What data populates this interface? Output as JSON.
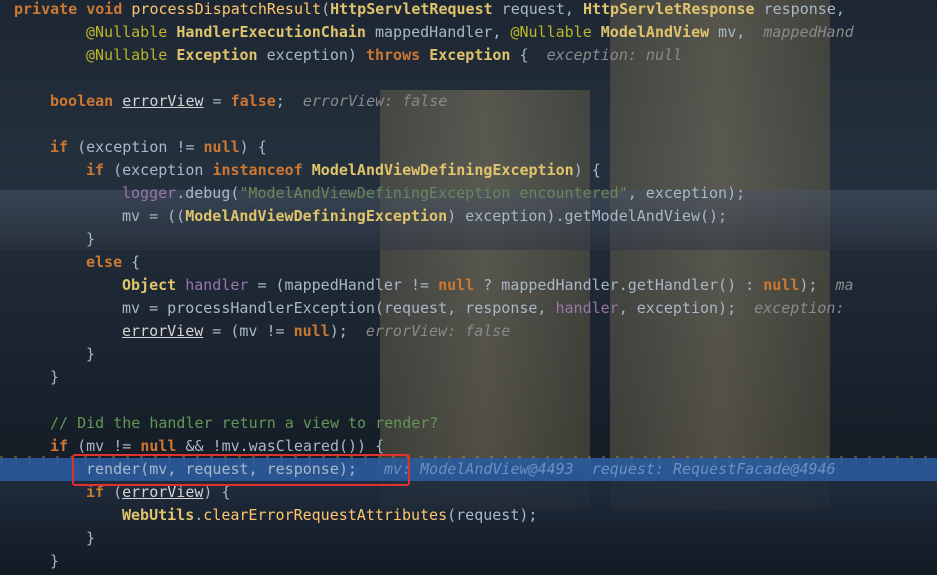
{
  "editor": {
    "lines": [
      {
        "id": "l1",
        "indent": 0,
        "tokens": [
          [
            "kw",
            "private void "
          ],
          [
            "fu",
            "processDispatchResult"
          ],
          [
            "pa",
            "("
          ],
          [
            "ty",
            "HttpServletRequest"
          ],
          [
            "pa",
            " request, "
          ],
          [
            "ty",
            "HttpServletResponse"
          ],
          [
            "pa",
            " response,"
          ]
        ]
      },
      {
        "id": "l2",
        "indent": 8,
        "tokens": [
          [
            "an",
            "@Nullable "
          ],
          [
            "ty",
            "HandlerExecutionChain"
          ],
          [
            "pa",
            " mappedHandler, "
          ],
          [
            "an",
            "@Nullable "
          ],
          [
            "ty",
            "ModelAndView"
          ],
          [
            "pa",
            " mv,  "
          ],
          [
            "hint",
            "mappedHand"
          ]
        ]
      },
      {
        "id": "l3",
        "indent": 8,
        "tokens": [
          [
            "an",
            "@Nullable "
          ],
          [
            "ty",
            "Exception"
          ],
          [
            "pa",
            " exception) "
          ],
          [
            "kw",
            "throws "
          ],
          [
            "ty",
            "Exception"
          ],
          [
            "pa",
            " {  "
          ],
          [
            "hint",
            "exception: null"
          ]
        ]
      },
      {
        "id": "l4",
        "indent": 0,
        "tokens": []
      },
      {
        "id": "l5",
        "indent": 4,
        "tokens": [
          [
            "kw",
            "boolean "
          ],
          [
            "un",
            "errorView"
          ],
          [
            "pa",
            " = "
          ],
          [
            "kw",
            "false"
          ],
          [
            "pa",
            ";  "
          ],
          [
            "hint",
            "errorView: false"
          ]
        ]
      },
      {
        "id": "l6",
        "indent": 0,
        "tokens": []
      },
      {
        "id": "l7",
        "indent": 4,
        "tokens": [
          [
            "kw",
            "if "
          ],
          [
            "pa",
            "(exception != "
          ],
          [
            "kw",
            "null"
          ],
          [
            "pa",
            ") {"
          ]
        ]
      },
      {
        "id": "l8",
        "indent": 8,
        "tokens": [
          [
            "kw",
            "if "
          ],
          [
            "pa",
            "(exception "
          ],
          [
            "kw",
            "instanceof "
          ],
          [
            "ty",
            "ModelAndViewDefiningException"
          ],
          [
            "pa",
            ") {"
          ]
        ]
      },
      {
        "id": "l9",
        "indent": 12,
        "tokens": [
          [
            "fd",
            "logger"
          ],
          [
            "pa",
            ".debug("
          ],
          [
            "st",
            "\"ModelAndViewDefiningException encountered\""
          ],
          [
            "pa",
            ", exception);"
          ]
        ]
      },
      {
        "id": "l10",
        "indent": 12,
        "tokens": [
          [
            "pa",
            "mv = (("
          ],
          [
            "ty",
            "ModelAndViewDefiningException"
          ],
          [
            "pa",
            ") exception).getModelAndView();"
          ]
        ]
      },
      {
        "id": "l11",
        "indent": 8,
        "tokens": [
          [
            "pa",
            "}"
          ]
        ]
      },
      {
        "id": "l12",
        "indent": 8,
        "tokens": [
          [
            "kw",
            "else "
          ],
          [
            "pa",
            "{"
          ]
        ]
      },
      {
        "id": "l13",
        "indent": 12,
        "tokens": [
          [
            "ty",
            "Object "
          ],
          [
            "fd",
            "handler"
          ],
          [
            "pa",
            " = (mappedHandler != "
          ],
          [
            "kw",
            "null"
          ],
          [
            "pa",
            " ? mappedHandler.getHandler() : "
          ],
          [
            "kw",
            "null"
          ],
          [
            "pa",
            ");  "
          ],
          [
            "hint",
            "ma"
          ]
        ]
      },
      {
        "id": "l14",
        "indent": 12,
        "tokens": [
          [
            "pa",
            "mv = processHandlerException(request, response, "
          ],
          [
            "fd",
            "handler"
          ],
          [
            "pa",
            ", exception);  "
          ],
          [
            "hint",
            "exception:"
          ]
        ]
      },
      {
        "id": "l15",
        "indent": 12,
        "tokens": [
          [
            "un",
            "errorView"
          ],
          [
            "pa",
            " = (mv != "
          ],
          [
            "kw",
            "null"
          ],
          [
            "pa",
            ");  "
          ],
          [
            "hint",
            "errorView: false"
          ]
        ]
      },
      {
        "id": "l16",
        "indent": 8,
        "tokens": [
          [
            "pa",
            "}"
          ]
        ]
      },
      {
        "id": "l17",
        "indent": 4,
        "tokens": [
          [
            "pa",
            "}"
          ]
        ]
      },
      {
        "id": "l18",
        "indent": 0,
        "tokens": []
      },
      {
        "id": "l19",
        "indent": 4,
        "tokens": [
          [
            "cm",
            "// Did the handler return a view to render?"
          ]
        ]
      },
      {
        "id": "l20",
        "indent": 4,
        "tokens": [
          [
            "kw",
            "if "
          ],
          [
            "pa",
            "(mv != "
          ],
          [
            "kw",
            "null"
          ],
          [
            "pa",
            " && !mv.wasCleared()) {"
          ]
        ]
      },
      {
        "id": "l21",
        "indent": 8,
        "tokens": [
          [
            "pa",
            "render(mv, request, response);"
          ],
          [
            "hl-hint",
            "   mv: ModelAndView@4493  request: RequestFacade@4946"
          ]
        ]
      },
      {
        "id": "l22",
        "indent": 8,
        "tokens": [
          [
            "kw",
            "if "
          ],
          [
            "pa",
            "("
          ],
          [
            "un",
            "errorView"
          ],
          [
            "pa",
            ") {"
          ]
        ]
      },
      {
        "id": "l23",
        "indent": 12,
        "tokens": [
          [
            "ty",
            "WebUtils"
          ],
          [
            "pa",
            "."
          ],
          [
            "fu",
            "clearErrorRequestAttributes"
          ],
          [
            "pa",
            "(request);"
          ]
        ]
      },
      {
        "id": "l24",
        "indent": 8,
        "tokens": [
          [
            "pa",
            "}"
          ]
        ]
      },
      {
        "id": "l25",
        "indent": 4,
        "tokens": [
          [
            "pa",
            "}"
          ]
        ]
      }
    ],
    "current_line_id": "l21",
    "highlight_color": "#2a5a9a",
    "box_color": "#e03030"
  }
}
